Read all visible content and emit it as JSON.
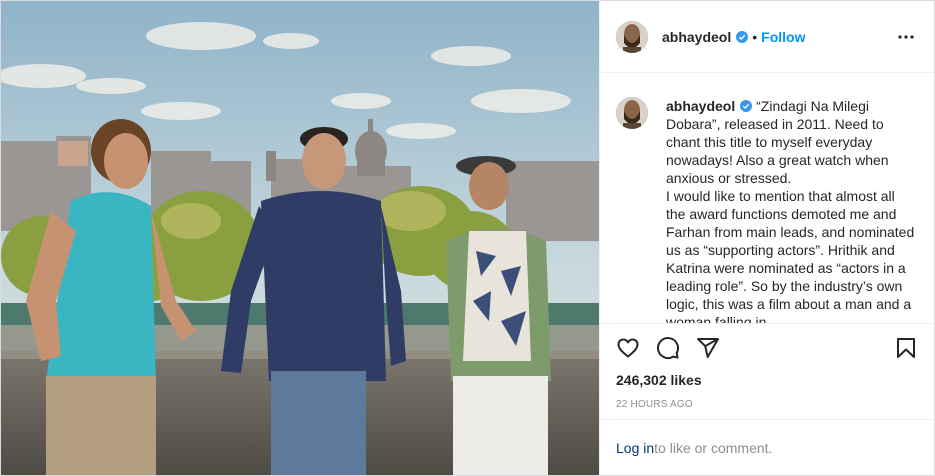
{
  "post": {
    "username": "abhaydeol",
    "follow_label": "Follow",
    "separator": "•",
    "caption": "“Zindagi Na Milegi Dobara”, released in 2011. Need to chant this title to myself everyday nowadays! Also a great watch when anxious or stressed.\nI would like to mention that almost all the award functions demoted me and Farhan from main leads, and nominated us as “supporting actors”. Hrithik and Katrina were nominated as “actors in a leading role”. So by the industry’s own logic, this was a film about a man and a woman falling in",
    "likes": "246,302 likes",
    "timestamp": "22 HOURS AGO",
    "login_link": "Log in",
    "login_rest": " to like or comment."
  },
  "icons": {
    "verified": "verified-badge-icon",
    "more": "more-options-icon",
    "like": "heart-icon",
    "comment": "comment-icon",
    "share": "share-icon",
    "save": "bookmark-icon"
  },
  "colors": {
    "follow": "#0095f6",
    "verified": "#3897f0",
    "link": "#00376b",
    "muted": "#8e8e8e"
  }
}
